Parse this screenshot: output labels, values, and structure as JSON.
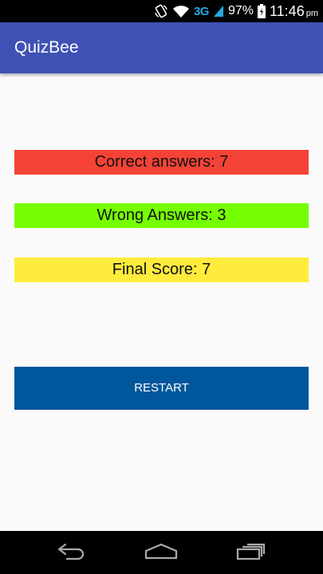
{
  "status_bar": {
    "network": "3G",
    "battery": "97%",
    "time": "11:46",
    "ampm": "pm",
    "icons": [
      "rotate-icon",
      "wifi-icon",
      "signal-icon",
      "battery-icon"
    ]
  },
  "app_bar": {
    "title": "QuizBee",
    "color": "#3f51b5"
  },
  "results": {
    "correct": {
      "text": "Correct answers: 7",
      "color": "#f44336"
    },
    "wrong": {
      "text": "Wrong Answers: 3",
      "color": "#76ff03"
    },
    "score": {
      "text": "Final Score: 7",
      "color": "#ffeb3b"
    }
  },
  "restart": {
    "label": "RESTART",
    "color": "#01579b"
  },
  "nav_bar": {
    "icons": [
      "back-icon",
      "home-icon",
      "recents-icon"
    ]
  }
}
